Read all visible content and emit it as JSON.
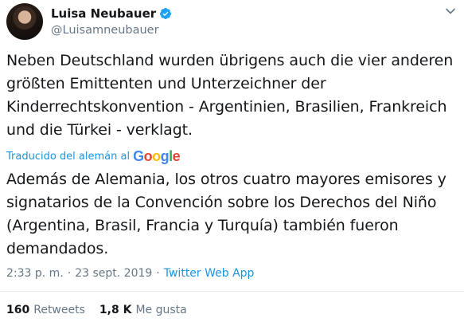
{
  "author": {
    "display_name": "Luisa Neubauer",
    "handle": "@Luisamneubauer",
    "verified": true
  },
  "tweet": {
    "text": "Neben Deutschland wurden übrigens auch die vier anderen größten Emittenten und Unterzeichner der Kinderrechtskonvention - Argentinien, Brasilien, Frankreich und die Türkei - verklagt.",
    "translated_label": "Traducido del alemán al",
    "translation_provider": "Google",
    "translation": "Además de Alemania, los otros cuatro mayores emisores y signatarios de la Convención sobre los Derechos del Niño (Argentina, Brasil, Francia y Turquía) también fueron demandados."
  },
  "meta": {
    "time": "2:33 p. m.",
    "separator": "·",
    "date": "23 sept. 2019",
    "source": "Twitter Web App"
  },
  "stats": {
    "retweets_count": "160",
    "retweets_label": "Retweets",
    "likes_count": "1,8 K",
    "likes_label": "Me gusta"
  },
  "icons": {
    "verified": "verified-badge-icon",
    "menu": "chevron-down-icon",
    "google": "google-logo"
  },
  "colors": {
    "link": "#1b95e0",
    "muted": "#657786",
    "text": "#14171a",
    "verified": "#1da1f2"
  }
}
